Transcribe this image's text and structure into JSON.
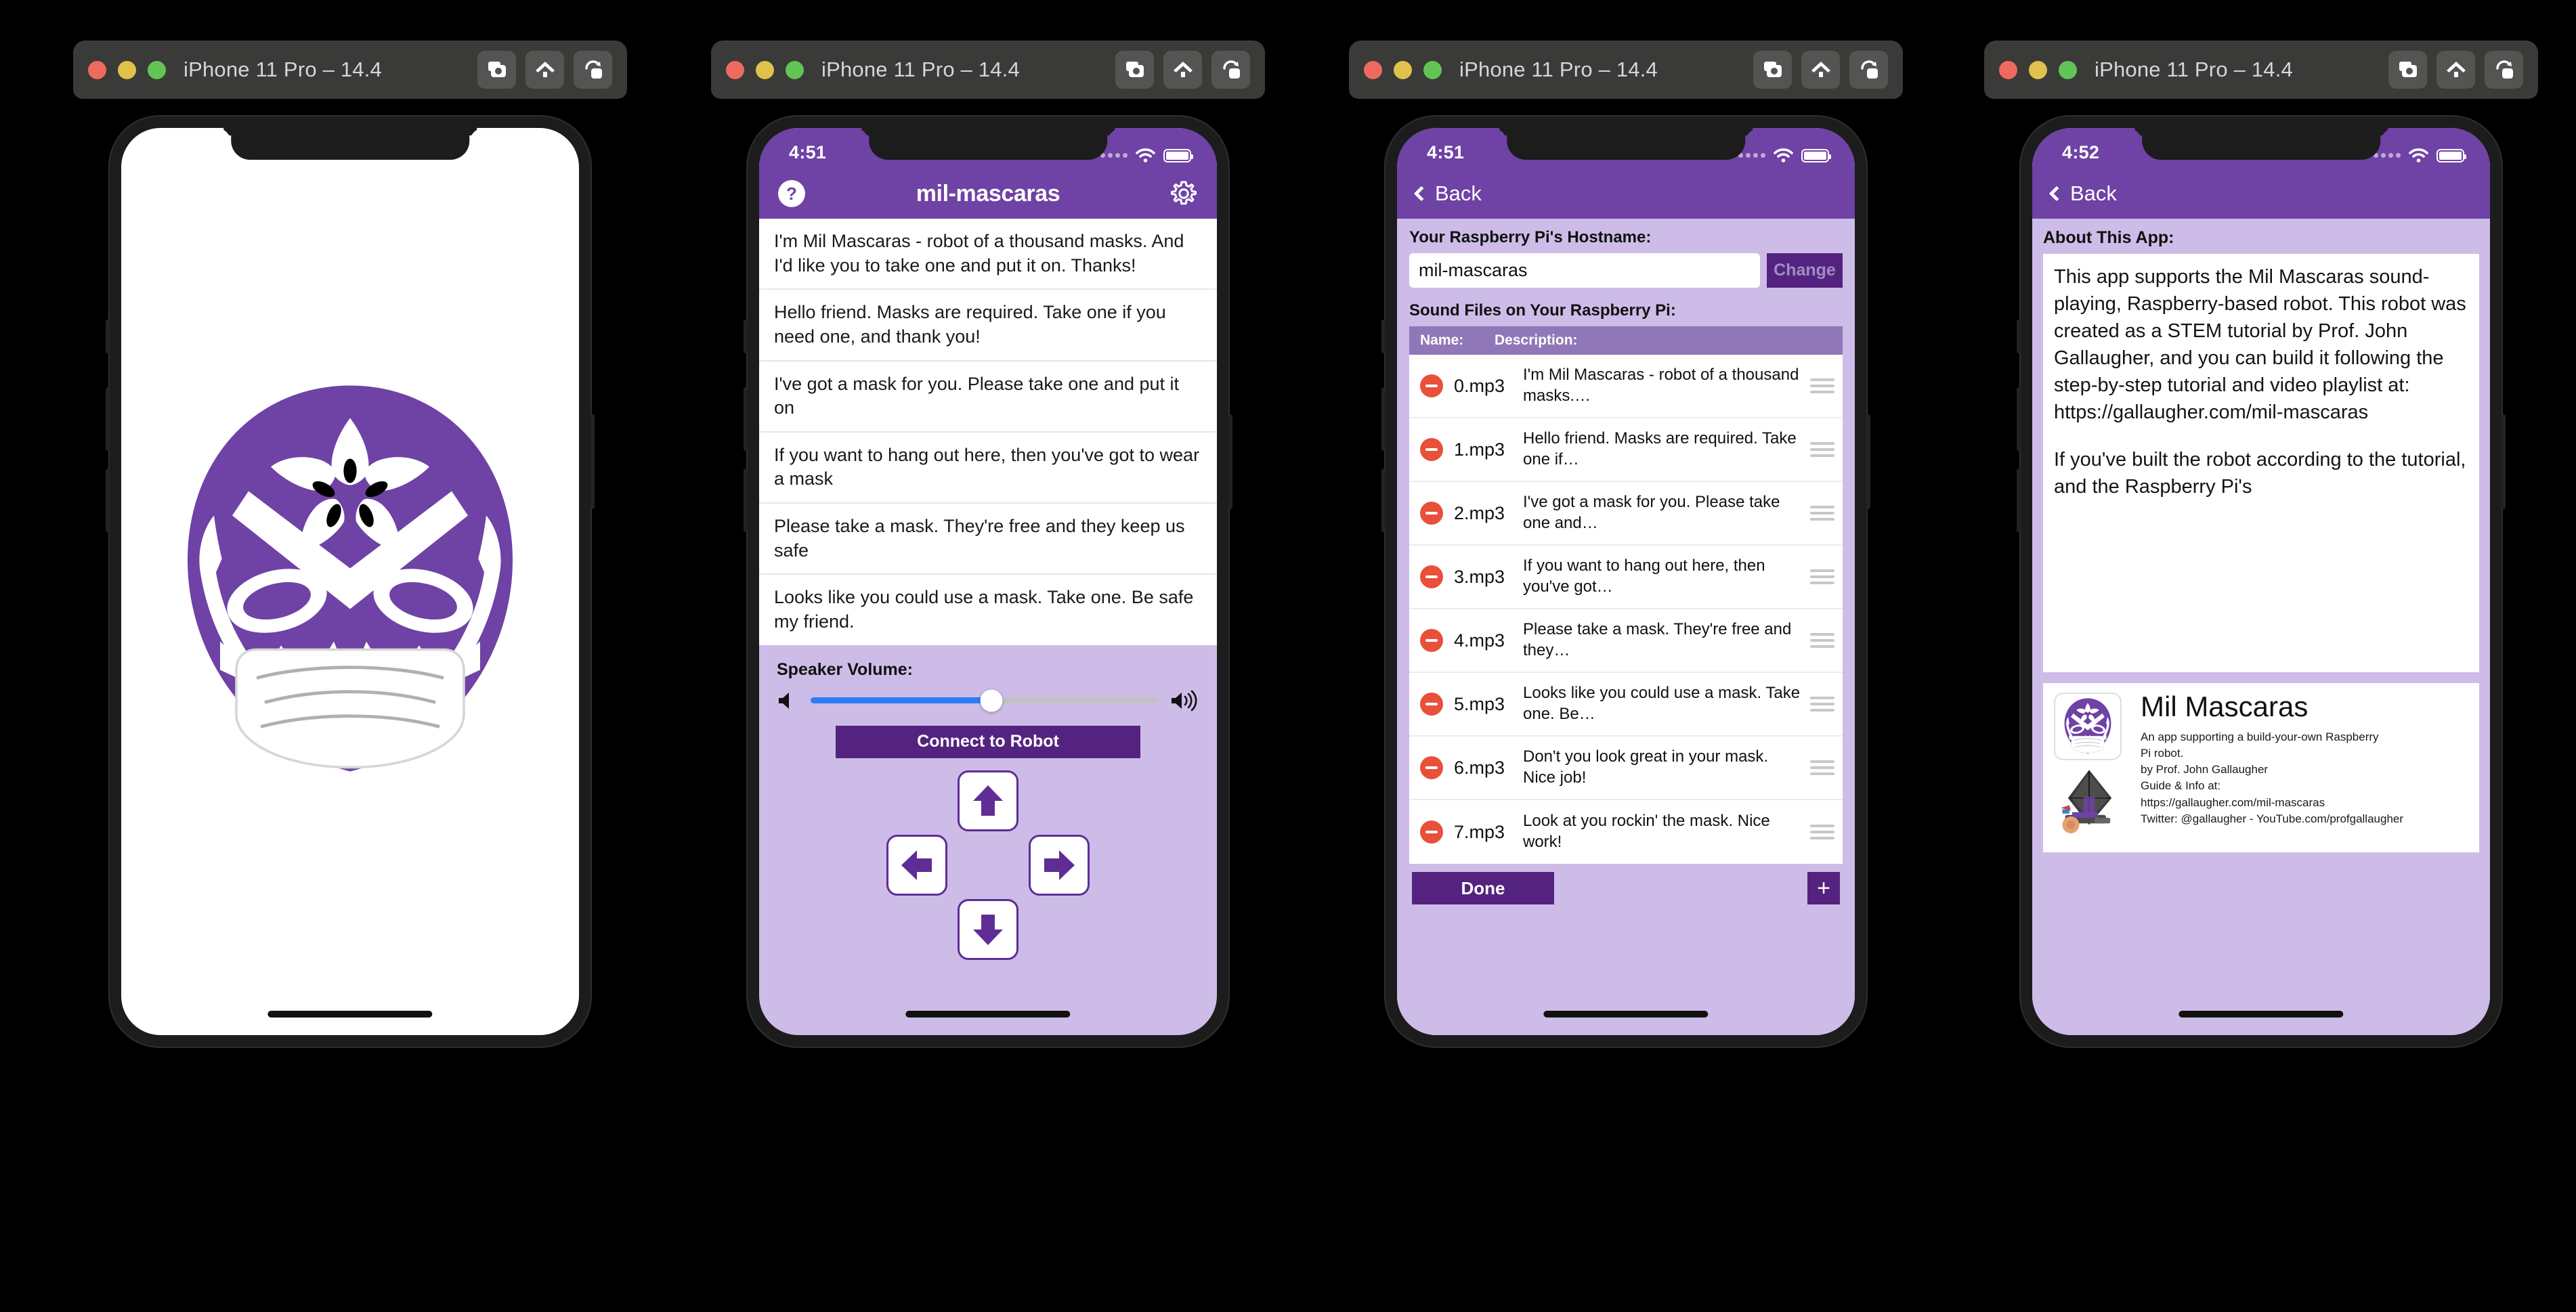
{
  "window": {
    "title": "iPhone 11 Pro – 14.4",
    "tools": [
      {
        "name": "screenshot-button",
        "icon": "camera-icon"
      },
      {
        "name": "home-button",
        "icon": "home-icon"
      },
      {
        "name": "rotate-button",
        "icon": "rotate-icon"
      }
    ],
    "traffic": {
      "close": "close",
      "minimize": "minimize",
      "zoom": "zoom"
    }
  },
  "phone1": {
    "logo_alt": "mil-mascaras-logo"
  },
  "phone2": {
    "status": {
      "time": "4:51"
    },
    "navbar": {
      "help": "?",
      "title": "mil-mascaras",
      "gear": "gear-icon"
    },
    "messages": [
      "I'm Mil Mascaras - robot of a thousand masks. And I'd like you to take one and put it on. Thanks!",
      "Hello friend. Masks are required. Take one if you need one, and thank you!",
      "I've got a mask for you. Please take one and put it on",
      "If you want to hang out here, then you've got to wear a mask",
      "Please take a mask. They're free and they keep us safe",
      "Looks like you could use a mask. Take one. Be safe my friend."
    ],
    "volume": {
      "label": "Speaker Volume:",
      "value": 52
    },
    "connect_label": "Connect to Robot",
    "dpad": {
      "up": "up-arrow",
      "down": "down-arrow",
      "left": "left-arrow",
      "right": "right-arrow"
    }
  },
  "phone3": {
    "status": {
      "time": "4:51"
    },
    "navbar": {
      "back": "Back"
    },
    "hostname": {
      "label": "Your Raspberry Pi's Hostname:",
      "value": "mil-mascaras",
      "button": "Change"
    },
    "files": {
      "label": "Sound Files on Your Raspberry Pi:",
      "columns": {
        "name": "Name:",
        "description": "Description:"
      },
      "rows": [
        {
          "name": "0.mp3",
          "description": "I'm Mil Mascaras - robot of a thousand masks.…"
        },
        {
          "name": "1.mp3",
          "description": "Hello friend. Masks are required. Take one if…"
        },
        {
          "name": "2.mp3",
          "description": "I've got a mask for you. Please take one and…"
        },
        {
          "name": "3.mp3",
          "description": "If you want to hang out here, then you've got…"
        },
        {
          "name": "4.mp3",
          "description": "Please take a mask. They're free and they…"
        },
        {
          "name": "5.mp3",
          "description": "Looks like you could use a mask. Take one. Be…"
        },
        {
          "name": "6.mp3",
          "description": "Don't you look great in your mask. Nice job!"
        },
        {
          "name": "7.mp3",
          "description": "Look at you rockin' the mask. Nice work!"
        }
      ]
    },
    "done_label": "Done",
    "add_label": "+"
  },
  "phone4": {
    "status": {
      "time": "4:52"
    },
    "navbar": {
      "back": "Back"
    },
    "about": {
      "label": "About This App:",
      "paragraphs": [
        "This app supports the Mil Mascaras sound-playing, Raspberry-based robot. This robot was created as a STEM tutorial by Prof. John Gallaugher, and you can build it following the step-by-step tutorial and video playlist at: https://gallaugher.com/mil-mascaras",
        "If you've built the robot according to the tutorial, and the Raspberry Pi's"
      ]
    },
    "credit": {
      "title": "Mil Mascaras",
      "lines": [
        "An app supporting a build-your-own Raspberry",
        "Pi robot.",
        "by Prof. John Gallaugher",
        "Guide & Info at:",
        "https://gallaugher.com/mil-mascaras",
        "Twitter: @gallaugher - YouTube.com/profgallaugher"
      ]
    }
  },
  "colors": {
    "nav_purple": "#6f42a5",
    "lilac": "#cdbce8",
    "deep_purple": "#54237f",
    "red": "#e8503a",
    "slider_blue": "#2f7cf6"
  }
}
